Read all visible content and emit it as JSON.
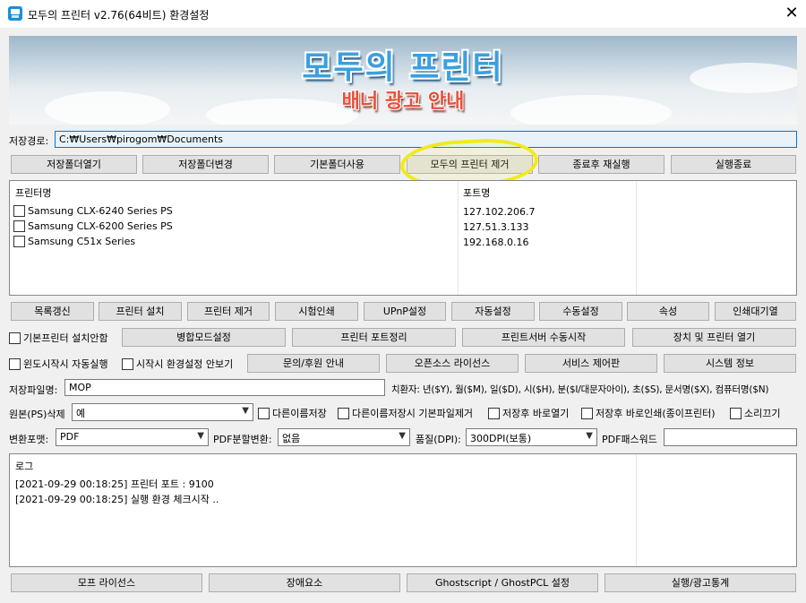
{
  "window": {
    "title": "모두의 프린터 v2.76(64비트) 환경설정",
    "close_label": "✕"
  },
  "banner": {
    "title": "모두의 프린터",
    "subtitle": "배너 광고 안내"
  },
  "save_path": {
    "label": "저장경로:",
    "value": "C:₩Users₩pirogom₩Documents"
  },
  "toolbar1": [
    "저장폴더열기",
    "저장폴더변경",
    "기본폴더사용",
    "모두의 프린터 제거",
    "종료후 재실행",
    "실행종료"
  ],
  "printer_list": {
    "col_name": "프린터명",
    "col_port": "포트명",
    "rows": [
      {
        "name": "Samsung CLX-6240 Series PS",
        "port": "127.102.206.7"
      },
      {
        "name": "Samsung CLX-6200 Series PS",
        "port": "127.51.3.133"
      },
      {
        "name": "Samsung C51x Series",
        "port": "192.168.0.16"
      }
    ]
  },
  "toolbar2": [
    "목록갱신",
    "프린터 설치",
    "프린터 제거",
    "시험인쇄",
    "UPnP설정",
    "자동설정",
    "수동설정",
    "속성",
    "인쇄대기열"
  ],
  "row3": {
    "check_default": "기본프린터 설치안함",
    "buttons": [
      "병합모드설정",
      "프린터 포트정리",
      "프린트서버 수동시작",
      "장치 및 프린터 열기"
    ]
  },
  "row4": {
    "check_autostart": "윈도시작시 자동실행",
    "check_hide_settings": "시작시 환경설정 안보기",
    "buttons": [
      "문의/후원 안내",
      "오픈소스 라이선스",
      "서비스 제어판",
      "시스템 정보"
    ]
  },
  "filename": {
    "label": "저장파일명:",
    "value": "MOP",
    "subst_help": "치환자: 년($Y), 월($M), 일($D), 시($H), 분($I/대문자아이), 초($S), 문서명($X), 컴퓨터명($N)"
  },
  "delete_row": {
    "label": "원본(PS)삭제",
    "selected": "예",
    "checks": [
      "다른이름저장",
      "다른이름저장시 기본파일제거",
      "저장후 바로열기",
      "저장후 바로인쇄(종이프린터)",
      "소리끄기"
    ]
  },
  "convert_row": {
    "format_label": "변환포맷:",
    "format_value": "PDF",
    "split_label": "PDF분할변환:",
    "split_value": "없음",
    "quality_label": "품질(DPI):",
    "quality_value": "300DPI(보통)",
    "password_label": "PDF패스워드",
    "password_value": ""
  },
  "log": {
    "header": "로그",
    "lines": [
      "[2021-09-29 00:18:25] 프린터 포트 : 9100",
      "[2021-09-29 00:18:25] 실행 환경 체크시작 .."
    ]
  },
  "bottom": [
    "모프 라이선스",
    "장애요소",
    "Ghostscript / GhostPCL 설정",
    "실행/광고통계"
  ],
  "colors": {
    "highlight": "#f2ea1a",
    "accent": "#0078d7"
  }
}
